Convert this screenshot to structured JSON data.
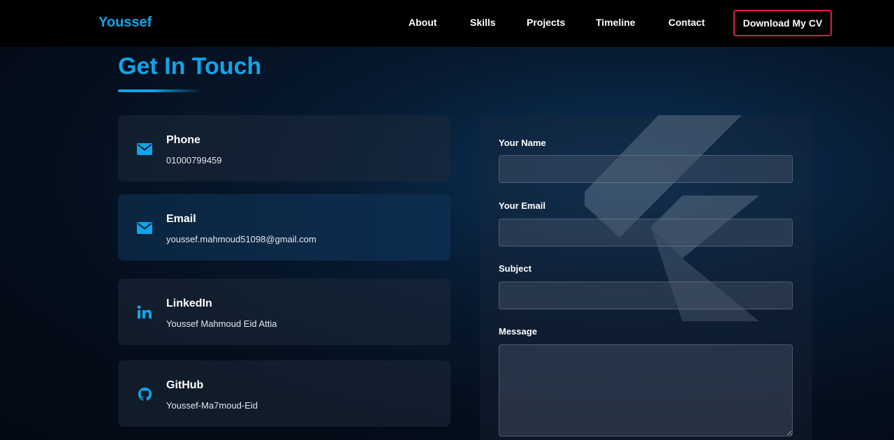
{
  "nav": {
    "brand": "Youssef",
    "links": [
      "About",
      "Skills",
      "Projects",
      "Timeline",
      "Contact"
    ],
    "cv_button": "Download My CV"
  },
  "section": {
    "title": "Get In Touch"
  },
  "contacts": [
    {
      "label": "Phone",
      "value": "01000799459",
      "icon": "envelope-icon"
    },
    {
      "label": "Email",
      "value": "youssef.mahmoud51098@gmail.com",
      "icon": "envelope-icon"
    },
    {
      "label": "LinkedIn",
      "value": "Youssef Mahmoud Eid Attia",
      "icon": "linkedin-icon"
    },
    {
      "label": "GitHub",
      "value": "Youssef-Ma7moud-Eid",
      "icon": "github-icon"
    }
  ],
  "form": {
    "name_label": "Your Name",
    "email_label": "Your Email",
    "subject_label": "Subject",
    "message_label": "Message"
  },
  "colors": {
    "accent": "#0ea5e9",
    "cv_border": "#e11d48",
    "navbar": "#000000"
  }
}
